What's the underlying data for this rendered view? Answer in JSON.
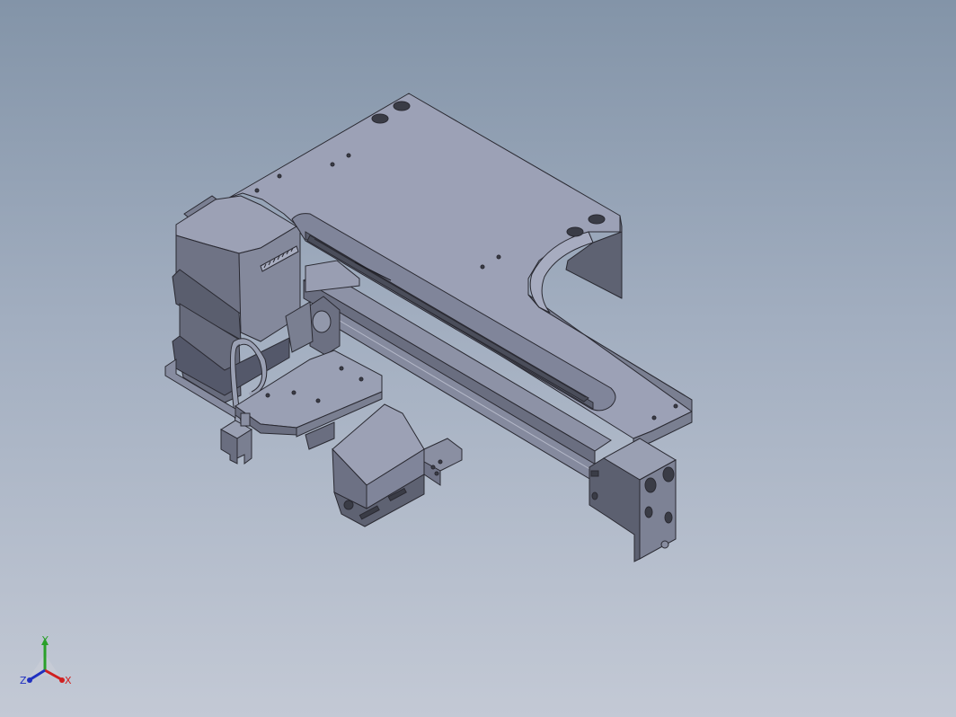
{
  "viewport": {
    "background_top": "#8394a8",
    "background_bottom": "#c3c9d5",
    "model_color": "#9aa0b4",
    "model_dark": "#5c6070",
    "model_mid": "#7c8194",
    "edge_color": "#2a2a32"
  },
  "triad": {
    "y_label": "Y",
    "z_label": "Z",
    "x_label": "X",
    "y_color": "#2aa02a",
    "x_color": "#d02020",
    "z_color": "#2030c0"
  }
}
